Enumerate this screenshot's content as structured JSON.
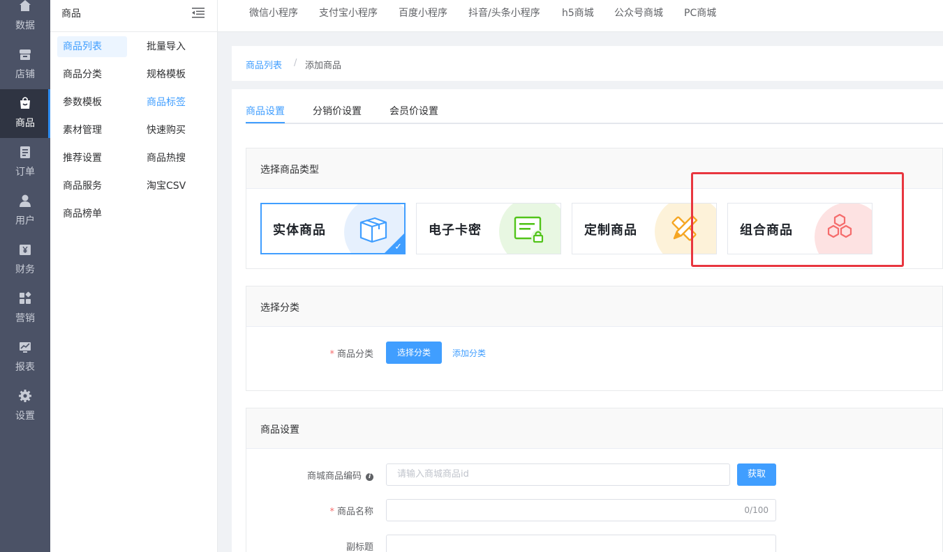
{
  "rail": {
    "items": [
      {
        "label": "数据",
        "icon": "home-icon"
      },
      {
        "label": "店铺",
        "icon": "store-icon"
      },
      {
        "label": "商品",
        "icon": "shopping-bag-icon",
        "active": true
      },
      {
        "label": "订单",
        "icon": "order-icon"
      },
      {
        "label": "用户",
        "icon": "user-icon"
      },
      {
        "label": "财务",
        "icon": "finance-icon"
      },
      {
        "label": "营销",
        "icon": "marketing-icon"
      },
      {
        "label": "报表",
        "icon": "report-icon"
      },
      {
        "label": "设置",
        "icon": "gear-icon"
      }
    ]
  },
  "submenu": {
    "title": "商品",
    "col1": [
      "商品列表",
      "商品分类",
      "参数模板",
      "素材管理",
      "推荐设置",
      "商品服务",
      "商品榜单"
    ],
    "col2": [
      "批量导入",
      "规格模板",
      "商品标签",
      "快速购买",
      "商品热搜",
      "淘宝CSV"
    ]
  },
  "topbar": {
    "tabs": [
      "微信小程序",
      "支付宝小程序",
      "百度小程序",
      "抖音/头条小程序",
      "h5商城",
      "公众号商城",
      "PC商城"
    ]
  },
  "breadcrumb": {
    "parent": "商品列表",
    "separator": "/",
    "current": "添加商品"
  },
  "tabs": [
    "商品设置",
    "分销价设置",
    "会员价设置"
  ],
  "goods_type": {
    "title": "选择商品类型",
    "cards": [
      {
        "name": "实体商品",
        "icon": "box-icon",
        "color": "#409eff",
        "selected": true
      },
      {
        "name": "电子卡密",
        "icon": "card-lock-icon",
        "color": "#52c41a",
        "selected": false
      },
      {
        "name": "定制商品",
        "icon": "pencil-ruler-icon",
        "color": "#f5a623",
        "selected": false
      },
      {
        "name": "组合商品",
        "icon": "hexagons-icon",
        "color": "#f56c6c",
        "selected": false
      }
    ]
  },
  "category": {
    "title": "选择分类",
    "label": "商品分类",
    "required_mark": "*",
    "select_button": "选择分类",
    "add_link": "添加分类"
  },
  "settings": {
    "title": "商品设置",
    "code_label": "商城商品编码",
    "code_placeholder": "请输入商城商品id",
    "fetch_button": "获取",
    "name_label": "商品名称",
    "name_counter": "0/100",
    "subtitle_label": "副标题"
  }
}
